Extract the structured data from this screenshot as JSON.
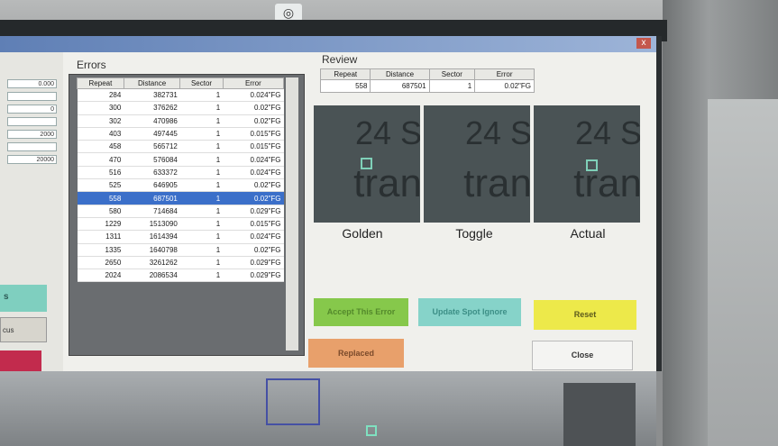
{
  "window": {
    "close_glyph": "x"
  },
  "left_panel": {
    "fields": [
      "0.000",
      "",
      "0",
      "",
      "2000",
      "",
      "20000"
    ],
    "green_label": "s",
    "grey_label": "cus"
  },
  "errors": {
    "title": "Errors",
    "columns": [
      "Repeat",
      "Distance",
      "Sector",
      "Error"
    ],
    "rows": [
      [
        "284",
        "382731",
        "1",
        "0.024\"FG"
      ],
      [
        "300",
        "376262",
        "1",
        "0.02\"FG"
      ],
      [
        "302",
        "470986",
        "1",
        "0.02\"FG"
      ],
      [
        "403",
        "497445",
        "1",
        "0.015\"FG"
      ],
      [
        "458",
        "565712",
        "1",
        "0.015\"FG"
      ],
      [
        "470",
        "576084",
        "1",
        "0.024\"FG"
      ],
      [
        "516",
        "633372",
        "1",
        "0.024\"FG"
      ],
      [
        "525",
        "646905",
        "1",
        "0.02\"FG"
      ],
      [
        "558",
        "687501",
        "1",
        "0.02\"FG"
      ],
      [
        "580",
        "714684",
        "1",
        "0.029\"FG"
      ],
      [
        "1229",
        "1513090",
        "1",
        "0.015\"FG"
      ],
      [
        "1311",
        "1614394",
        "1",
        "0.024\"FG"
      ],
      [
        "1335",
        "1640798",
        "1",
        "0.02\"FG"
      ],
      [
        "2650",
        "3261262",
        "1",
        "0.029\"FG"
      ],
      [
        "2024",
        "2086534",
        "1",
        "0.029\"FG"
      ]
    ],
    "selected_index": 8
  },
  "review": {
    "title": "Review",
    "columns": [
      "Repeat",
      "Distance",
      "Sector",
      "Error"
    ],
    "row": [
      "558",
      "687501",
      "1",
      "0.02\"FG"
    ],
    "image_text_line1": "24 S",
    "image_text_line2": "tran",
    "images": [
      "Golden",
      "Toggle",
      "Actual"
    ]
  },
  "buttons": {
    "accept": "Accept This Error",
    "update": "Update Spot Ignore",
    "reset": "Reset",
    "replaced": "Replaced",
    "close": "Close"
  },
  "colors": {
    "selected_row": "#3b6fc9",
    "accept": "#86c84b",
    "update": "#86d3c9",
    "reset": "#ede94a",
    "replaced": "#e8a06b"
  }
}
